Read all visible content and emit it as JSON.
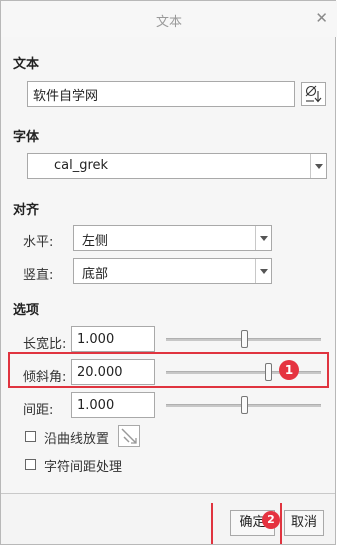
{
  "window": {
    "title": "文本",
    "close_icon": "close-icon"
  },
  "text_section": {
    "heading": "文本",
    "value": "软件自学网",
    "symbol_button_icon": "insert-symbol-icon"
  },
  "font_section": {
    "heading": "字体",
    "selected": "cal_grek"
  },
  "align_section": {
    "heading": "对齐",
    "horizontal_label": "水平:",
    "horizontal_value": "左侧",
    "vertical_label": "竖直:",
    "vertical_value": "底部"
  },
  "options_section": {
    "heading": "选项",
    "aspect_label": "长宽比:",
    "aspect_value": "1.000",
    "slant_label": "倾斜角:",
    "slant_value": "20.000",
    "spacing_label": "间距:",
    "spacing_value": "1.000",
    "follow_curve_label": "沿曲线放置",
    "follow_curve_checked": false,
    "char_spacing_label": "字符间距处理",
    "char_spacing_checked": false,
    "curve_button_icon": "curve-placement-icon"
  },
  "footer": {
    "ok_label": "确定",
    "cancel_label": "取消"
  },
  "annotations": {
    "badge1": "1",
    "badge2": "2",
    "highlight_color": "#e0343f"
  }
}
